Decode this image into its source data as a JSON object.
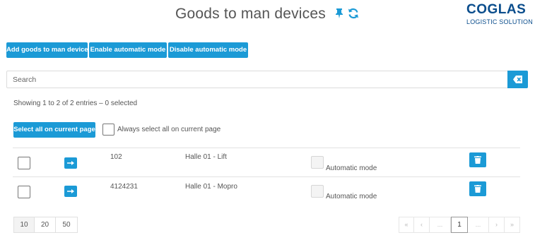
{
  "header": {
    "title": "Goods to man devices",
    "pin_icon": "pin-icon",
    "refresh_icon": "refresh-icon",
    "accent_color": "#1b9ad6"
  },
  "logo": {
    "main": "COGLAS",
    "sub": "LOGISTIC SOLUTION",
    "color": "#0a4d8c"
  },
  "toolbar": {
    "add_label": "Add goods to man device",
    "enable_label": "Enable automatic mode",
    "disable_label": "Disable automatic mode"
  },
  "search": {
    "placeholder": "Search",
    "value": "",
    "clear_icon": "eraser-icon"
  },
  "status": {
    "showing": "Showing 1 to 2 of 2 entries  –  0 selected"
  },
  "selection": {
    "select_all_label": "Select all on current page",
    "always_select_label": "Always select all on current page",
    "always_select_checked": false
  },
  "rows": [
    {
      "id": "102",
      "name": "Halle 01 - Lift",
      "auto_label": "Automatic mode",
      "auto_checked": false,
      "selected": false
    },
    {
      "id": "4124231",
      "name": "Halle 01 - Mopro",
      "auto_label": "Automatic mode",
      "auto_checked": false,
      "selected": false
    }
  ],
  "page_sizes": [
    "10",
    "20",
    "50"
  ],
  "selected_page_size": "10",
  "pagination": {
    "first": "«",
    "prev": "‹",
    "dots_before": "...",
    "current": "1",
    "dots_after": "...",
    "next": "›",
    "last": "»"
  }
}
